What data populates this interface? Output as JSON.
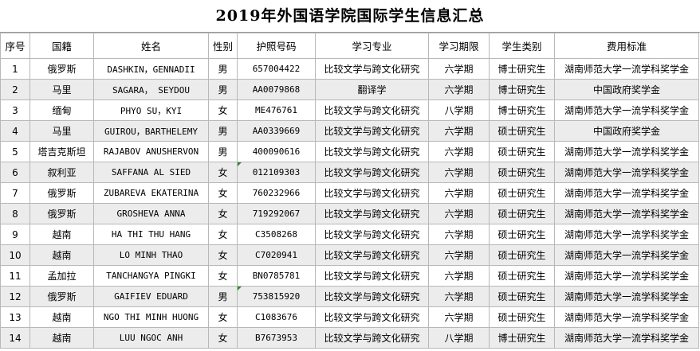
{
  "title": "2019年外国语学院国际学生信息汇总",
  "headers": [
    "序号",
    "国籍",
    "姓名",
    "性别",
    "护照号码",
    "学习专业",
    "学习期限",
    "学生类别",
    "费用标准"
  ],
  "rows": [
    [
      "1",
      "俄罗斯",
      "DASHKIN，GENNADII",
      "男",
      "657004422",
      "比较文学与跨文化研究",
      "六学期",
      "博士研究生",
      "湖南师范大学一流学科奖学金"
    ],
    [
      "2",
      "马里",
      "SAGARA， SEYDOU",
      "男",
      "AA0079868",
      "翻译学",
      "六学期",
      "博士研究生",
      "中国政府奖学金"
    ],
    [
      "3",
      "缅甸",
      "PHYO SU，KYI",
      "女",
      "ME476761",
      "比较文学与跨文化研究",
      "八学期",
      "博士研究生",
      "湖南师范大学一流学科奖学金"
    ],
    [
      "4",
      "马里",
      "GUIROU，BARTHELEMY",
      "男",
      "AA0339669",
      "比较文学与跨文化研究",
      "六学期",
      "硕士研究生",
      "中国政府奖学金"
    ],
    [
      "5",
      "塔吉克斯坦",
      "RAJABOV  ANUSHERVON",
      "男",
      "400090616",
      "比较文学与跨文化研究",
      "六学期",
      "硕士研究生",
      "湖南师范大学一流学科奖学金"
    ],
    [
      "6",
      "叙利亚",
      "SAFFANA  AL SIED",
      "女",
      "012109303",
      "比较文学与跨文化研究",
      "六学期",
      "硕士研究生",
      "湖南师范大学一流学科奖学金"
    ],
    [
      "7",
      "俄罗斯",
      "ZUBAREVA  EKATERINA",
      "女",
      "760232966",
      "比较文学与跨文化研究",
      "六学期",
      "硕士研究生",
      "湖南师范大学一流学科奖学金"
    ],
    [
      "8",
      "俄罗斯",
      "GROSHEVA  ANNA",
      "女",
      "719292067",
      "比较文学与跨文化研究",
      "六学期",
      "硕士研究生",
      "湖南师范大学一流学科奖学金"
    ],
    [
      "9",
      "越南",
      "HA THI THU HANG",
      "女",
      "C3508268",
      "比较文学与跨文化研究",
      "六学期",
      "硕士研究生",
      "湖南师范大学一流学科奖学金"
    ],
    [
      "10",
      "越南",
      "LO MINH THAO",
      "女",
      "C7020941",
      "比较文学与跨文化研究",
      "六学期",
      "硕士研究生",
      "湖南师范大学一流学科奖学金"
    ],
    [
      "11",
      "孟加拉",
      "TANCHANGYA PINGKI",
      "女",
      "BN0785781",
      "比较文学与跨文化研究",
      "六学期",
      "硕士研究生",
      "湖南师范大学一流学科奖学金"
    ],
    [
      "12",
      "俄罗斯",
      "GAIFIEV  EDUARD",
      "男",
      "753815920",
      "比较文学与跨文化研究",
      "六学期",
      "硕士研究生",
      "湖南师范大学一流学科奖学金"
    ],
    [
      "13",
      "越南",
      "NGO THI MINH HUONG",
      "女",
      "C1083676",
      "比较文学与跨文化研究",
      "六学期",
      "硕士研究生",
      "湖南师范大学一流学科奖学金"
    ],
    [
      "14",
      "越南",
      "LUU NGOC ANH",
      "女",
      "B7673953",
      "比较文学与跨文化研究",
      "八学期",
      "博士研究生",
      "湖南师范大学一流学科奖学金"
    ]
  ]
}
